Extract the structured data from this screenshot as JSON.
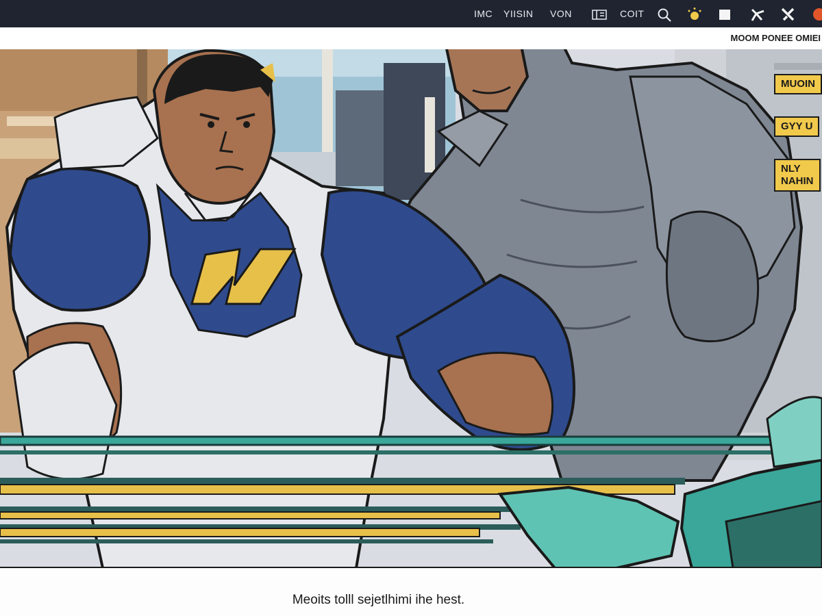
{
  "topbar": {
    "nav_items": [
      "IMC",
      "YIISIN",
      "VON",
      "COIT"
    ],
    "icons": [
      "list-icon",
      "search-icon",
      "brightness-icon",
      "square-icon",
      "share-icon",
      "tools-icon",
      "record-icon"
    ]
  },
  "subtitle": "MOOM PONEE OMIEI",
  "side_tags": [
    "MUOIN",
    "GYY U",
    "NLY\nNAHIN"
  ],
  "caption": "Meoits tolll sejetlhimi ihe hest.",
  "colors": {
    "topbar": "#1f2430",
    "tag": "#f1c94b",
    "accent_teal": "#3aa79a",
    "accent_yellow": "#e7c04a",
    "shirt_blue": "#2f4b8e",
    "record": "#e0562a"
  }
}
